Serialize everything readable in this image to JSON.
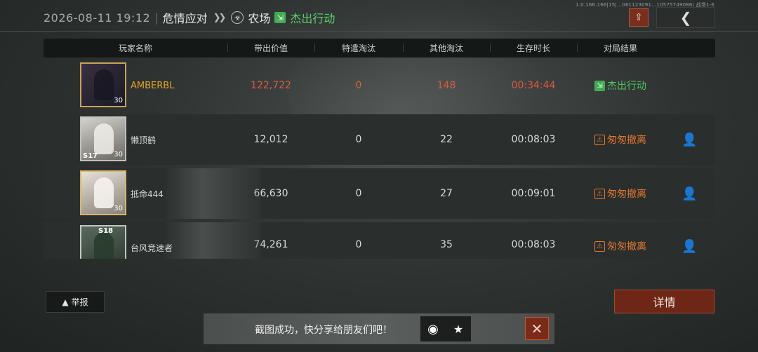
{
  "header": {
    "timestamp": "2026-08-11 19:12",
    "mode": "危情应对",
    "map": "农场",
    "result": "杰出行动",
    "serial": "1.0.166.166|15|...081123091...10575749086| 战场1-6"
  },
  "table": {
    "columns": [
      "玩家名称",
      "带出价值",
      "特遣淘汰",
      "其他淘汰",
      "生存时长",
      "对局结果"
    ],
    "rows": [
      {
        "name": "AMBERBL",
        "level": "30",
        "season": "",
        "value": "122,722",
        "special_kills": "0",
        "other_kills": "148",
        "survival": "00:34:44",
        "result": "杰出行动",
        "result_type": "escape"
      },
      {
        "name": "懒顶鹤",
        "level": "30",
        "season": "S17",
        "value": "12,012",
        "special_kills": "0",
        "other_kills": "22",
        "survival": "00:08:03",
        "result": "匆匆撤离",
        "result_type": "hurry"
      },
      {
        "name": "抵命444",
        "level": "30",
        "season": "",
        "value": "66,630",
        "special_kills": "0",
        "other_kills": "27",
        "survival": "00:09:01",
        "result": "匆匆撤离",
        "result_type": "hurry"
      },
      {
        "name": "台风竞速者",
        "level": "",
        "season": "S18",
        "value": "74,261",
        "special_kills": "0",
        "other_kills": "35",
        "survival": "00:08:03",
        "result": "匆匆撤离",
        "result_type": "hurry"
      }
    ]
  },
  "buttons": {
    "report": "举报",
    "details": "详情"
  },
  "toast": {
    "message": "截图成功，快分享给朋友们吧！"
  },
  "colors": {
    "accent_orange": "#e0593a",
    "escape_green": "#4fc25f",
    "hurry_orange": "#e2772e",
    "gold_name": "#e3a323"
  }
}
